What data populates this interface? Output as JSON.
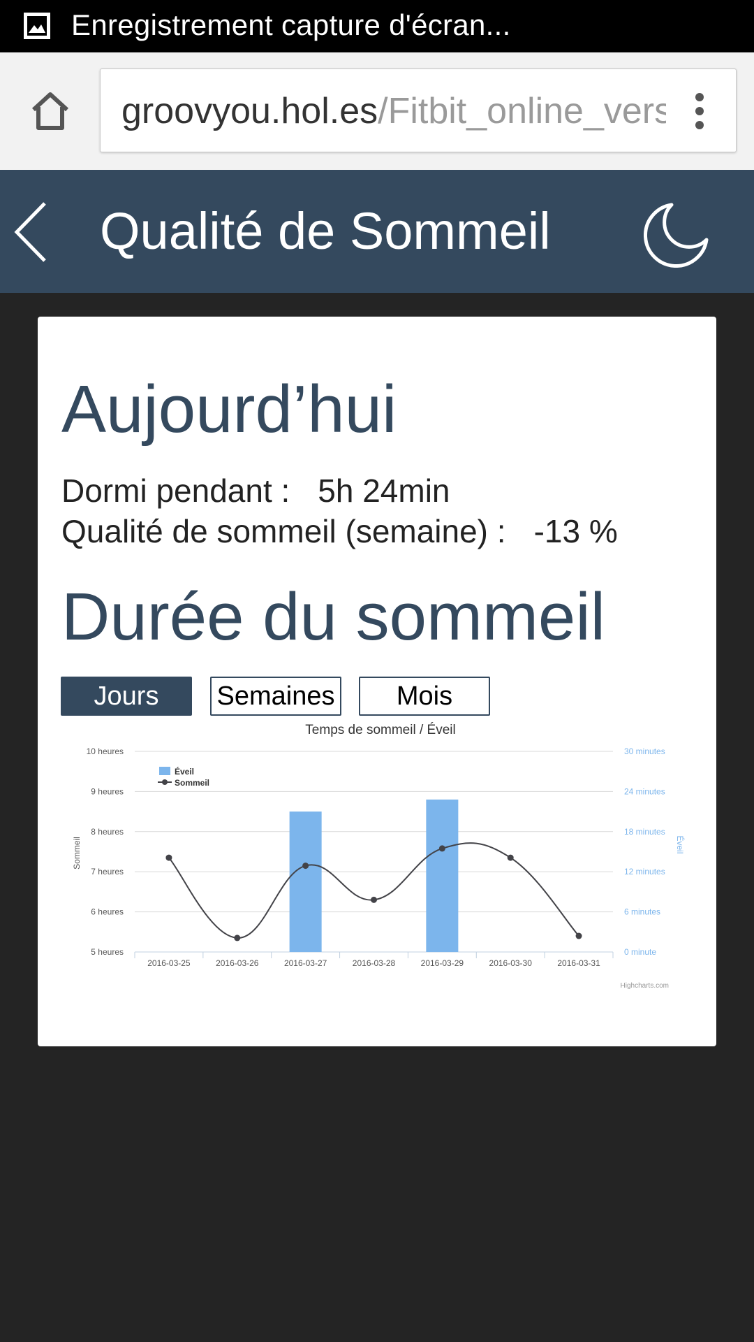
{
  "status_bar": {
    "notification_text": "Enregistrement capture d'écran...",
    "icon": "image-icon"
  },
  "browser": {
    "url_host": "groovyou.hol.es",
    "url_path": "/Fitbit_online_vers",
    "home_icon": "home-icon",
    "menu_icon": "overflow-menu-icon"
  },
  "header": {
    "title": "Qualité de Sommeil",
    "back_icon": "chevron-left-icon",
    "right_icon": "moon-icon",
    "bg_color": "#34495e"
  },
  "today": {
    "title": "Aujourd’hui",
    "slept_label": "Dormi pendant :",
    "slept_value": "5h 24min",
    "quality_label": "Qualité de sommeil (semaine) :",
    "quality_value": "-13 %"
  },
  "duration": {
    "title": "Durée du sommeil",
    "buttons": [
      {
        "label": "Jours",
        "active": true
      },
      {
        "label": "Semaines",
        "active": false
      },
      {
        "label": "Mois",
        "active": false
      }
    ]
  },
  "chart_data": {
    "type": "bar+line",
    "title": "Temps de sommeil / Éveil",
    "credits": "Highcharts.com",
    "categories": [
      "2016-03-25",
      "2016-03-26",
      "2016-03-27",
      "2016-03-28",
      "2016-03-29",
      "2016-03-30",
      "2016-03-31"
    ],
    "y_left": {
      "label": "Sommeil",
      "min": 5,
      "max": 10,
      "ticks": [
        {
          "value": 5,
          "label": "5 heures"
        },
        {
          "value": 6,
          "label": "6 heures"
        },
        {
          "value": 7,
          "label": "7 heures"
        },
        {
          "value": 8,
          "label": "8 heures"
        },
        {
          "value": 9,
          "label": "9 heures"
        },
        {
          "value": 10,
          "label": "10 heures"
        }
      ]
    },
    "y_right": {
      "label": "Éveil",
      "min": 0,
      "max": 30,
      "ticks": [
        {
          "value": 0,
          "label": "0 minute"
        },
        {
          "value": 6,
          "label": "6 minutes"
        },
        {
          "value": 12,
          "label": "12 minutes"
        },
        {
          "value": 18,
          "label": "18 minutes"
        },
        {
          "value": 24,
          "label": "24 minutes"
        },
        {
          "value": 30,
          "label": "30 minutes"
        }
      ]
    },
    "series": [
      {
        "name": "Éveil",
        "type": "column",
        "axis": "right",
        "color": "#7cb5ec",
        "values": [
          0,
          0,
          21,
          0,
          22.8,
          0,
          0
        ]
      },
      {
        "name": "Sommeil",
        "type": "spline",
        "axis": "left",
        "color": "#434348",
        "values": [
          7.35,
          5.35,
          7.15,
          6.3,
          7.58,
          7.35,
          5.4
        ]
      }
    ],
    "legend_position": "top-left",
    "grid": true
  }
}
